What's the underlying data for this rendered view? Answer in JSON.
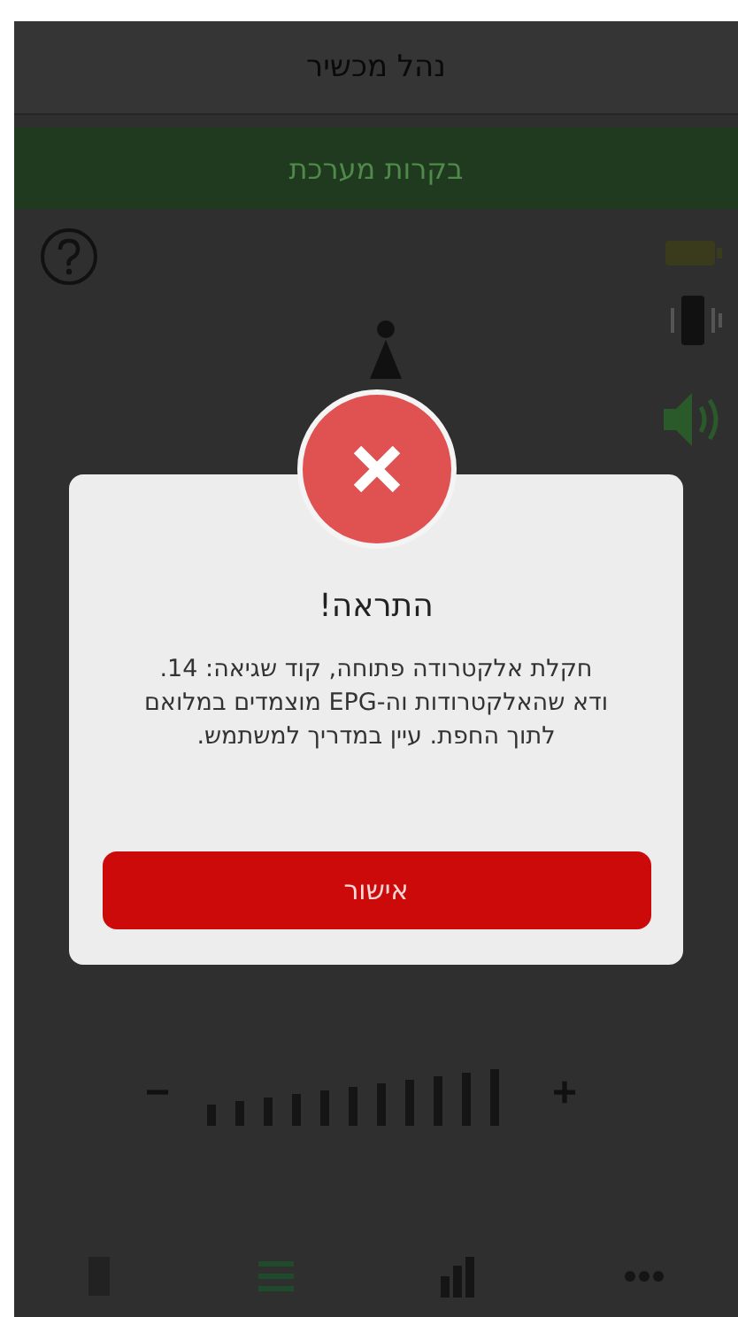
{
  "header": {
    "title": "נהל מכשיר"
  },
  "banner": {
    "title": "בקרות מערכת"
  },
  "dialog": {
    "title": "התראה!",
    "message": "חקלת אלקטרודה פתוחה, קוד שגיאה: 14. ודא שהאלקטרודות וה-EPG מוצמדים במלואם לתוך החפת. עיין במדריך למשתמש.",
    "confirm_button": "אישור"
  },
  "intensity": {
    "decrease": "−",
    "increase": "+"
  }
}
